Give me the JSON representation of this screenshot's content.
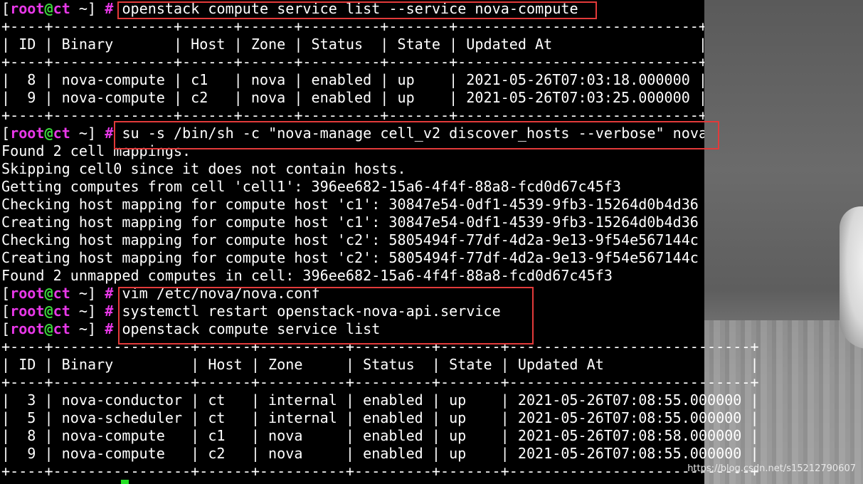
{
  "prompt": {
    "open": "[",
    "user": "root",
    "at": "@",
    "host": "ct",
    "sep": " ",
    "dir": "~",
    "close": "]",
    "hash": " #"
  },
  "lines": [
    {
      "type": "cmd",
      "text": " openstack compute service list --service nova-compute"
    },
    {
      "type": "out",
      "text": "+----+--------------+------+------+---------+-------+----------------------------+"
    },
    {
      "type": "out",
      "text": "| ID | Binary       | Host | Zone | Status  | State | Updated At                 |"
    },
    {
      "type": "out",
      "text": "+----+--------------+------+------+---------+-------+----------------------------+"
    },
    {
      "type": "out",
      "text": "|  8 | nova-compute | c1   | nova | enabled | up    | 2021-05-26T07:03:18.000000 |"
    },
    {
      "type": "out",
      "text": "|  9 | nova-compute | c2   | nova | enabled | up    | 2021-05-26T07:03:25.000000 |"
    },
    {
      "type": "out",
      "text": "+----+--------------+------+------+---------+-------+----------------------------+"
    },
    {
      "type": "cmd",
      "text": " su -s /bin/sh -c \"nova-manage cell_v2 discover_hosts --verbose\" nova"
    },
    {
      "type": "out",
      "text": "Found 2 cell mappings."
    },
    {
      "type": "out",
      "text": "Skipping cell0 since it does not contain hosts."
    },
    {
      "type": "out",
      "text": "Getting computes from cell 'cell1': 396ee682-15a6-4f4f-88a8-fcd0d67c45f3"
    },
    {
      "type": "out",
      "text": "Checking host mapping for compute host 'c1': 30847e54-0df1-4539-9fb3-15264d0b4d36"
    },
    {
      "type": "out",
      "text": "Creating host mapping for compute host 'c1': 30847e54-0df1-4539-9fb3-15264d0b4d36"
    },
    {
      "type": "out",
      "text": "Checking host mapping for compute host 'c2': 5805494f-77df-4d2a-9e13-9f54e567144c"
    },
    {
      "type": "out",
      "text": "Creating host mapping for compute host 'c2': 5805494f-77df-4d2a-9e13-9f54e567144c"
    },
    {
      "type": "out",
      "text": "Found 2 unmapped computes in cell: 396ee682-15a6-4f4f-88a8-fcd0d67c45f3"
    },
    {
      "type": "cmd",
      "text": " vim /etc/nova/nova.conf"
    },
    {
      "type": "cmd",
      "text": " systemctl restart openstack-nova-api.service"
    },
    {
      "type": "cmd",
      "text": " openstack compute service list"
    },
    {
      "type": "out",
      "text": "+----+----------------+------+----------+---------+-------+----------------------------+"
    },
    {
      "type": "out",
      "text": "| ID | Binary         | Host | Zone     | Status  | State | Updated At                 |"
    },
    {
      "type": "out",
      "text": "+----+----------------+------+----------+---------+-------+----------------------------+"
    },
    {
      "type": "out",
      "text": "|  3 | nova-conductor | ct   | internal | enabled | up    | 2021-05-26T07:08:55.000000 |"
    },
    {
      "type": "out",
      "text": "|  5 | nova-scheduler | ct   | internal | enabled | up    | 2021-05-26T07:08:55.000000 |"
    },
    {
      "type": "out",
      "text": "|  8 | nova-compute   | c1   | nova     | enabled | up    | 2021-05-26T07:08:58.000000 |"
    },
    {
      "type": "out",
      "text": "|  9 | nova-compute   | c2   | nova     | enabled | up    | 2021-05-26T07:08:55.000000 |"
    },
    {
      "type": "out",
      "text": "+----+----------------+------+----------+---------+-------+----------------------------+"
    }
  ],
  "watermark": "https://blog.csdn.net/s15212790607",
  "colors": {
    "background": "#000000",
    "text": "#ffffff",
    "prompt_user": "#e838e8",
    "prompt_at": "#3cd83c",
    "highlight_box": "#e23a3a",
    "cursor": "#25e025"
  }
}
